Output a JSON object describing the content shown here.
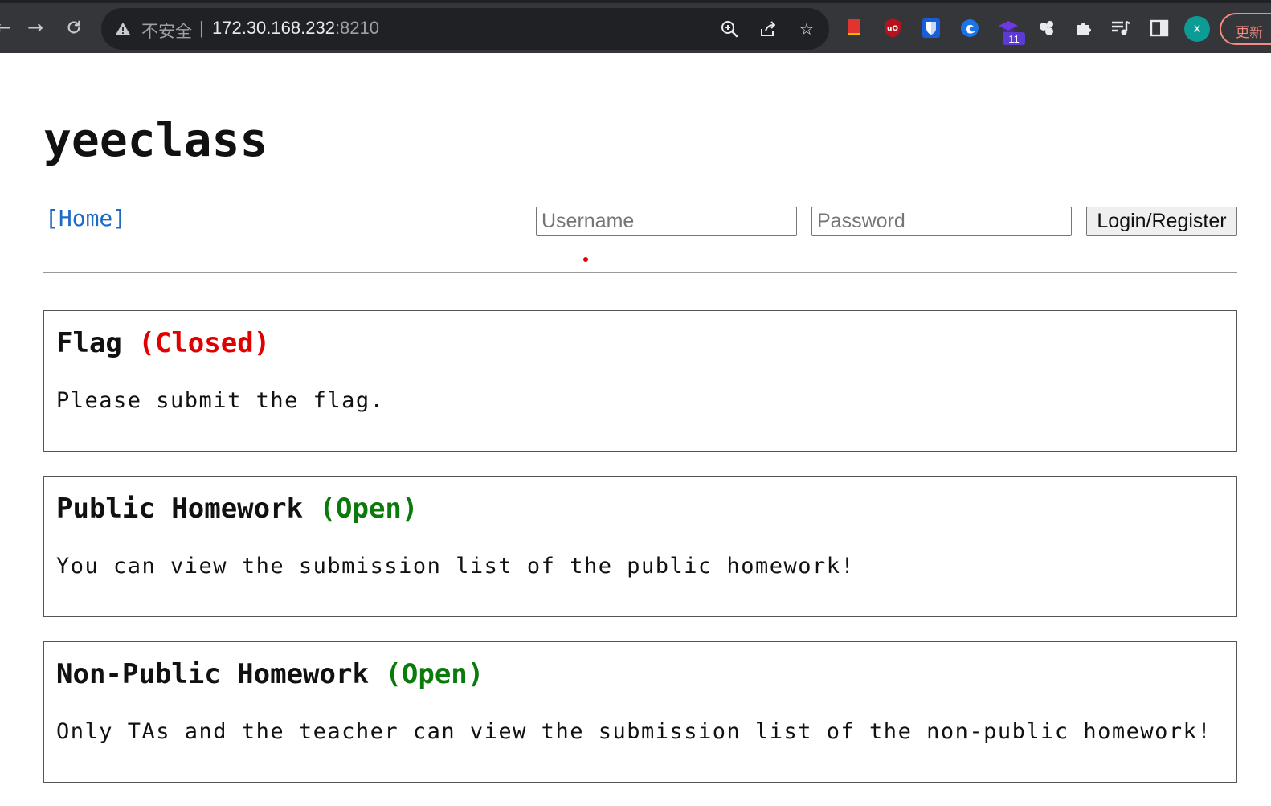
{
  "browser": {
    "back_icon": "arrow-left-icon",
    "forward_icon": "arrow-right-icon",
    "reload_icon": "reload-icon",
    "security_label": "不安全",
    "separator": "|",
    "url_host": "172.30.168.232",
    "url_port": ":8210",
    "zoom_icon": "zoom-icon",
    "share_icon": "share-icon",
    "bookmark_icon": "star-icon",
    "extensions": [
      {
        "name": "bookmark-ext-icon",
        "color": "#e0352f"
      },
      {
        "name": "ublock-icon",
        "color": "#b5121b",
        "text": "uO"
      },
      {
        "name": "bitwarden-icon",
        "color": "#175ddc"
      },
      {
        "name": "edge-ext-icon",
        "color": "#1a73e8"
      },
      {
        "name": "graduation-cap-ext-icon",
        "color": "#6c3ae0",
        "badge": "11"
      },
      {
        "name": "blobs-ext-icon",
        "color": "#e8eaed"
      },
      {
        "name": "puzzle-extensions-icon",
        "color": "#e8eaed"
      },
      {
        "name": "media-queue-icon",
        "color": "#e8eaed"
      },
      {
        "name": "sidepanel-icon",
        "color": "#e8eaed"
      }
    ],
    "profile_initial": "x",
    "update_label": "更新"
  },
  "site": {
    "title": "yeeclass",
    "home_link": "[Home]"
  },
  "login": {
    "username_placeholder": "Username",
    "password_placeholder": "Password",
    "submit_label": "Login/Register"
  },
  "homeworks": [
    {
      "name": "Flag",
      "status": "(Closed)",
      "status_color": "#e00000",
      "description": "Please submit the flag."
    },
    {
      "name": "Public Homework",
      "status": "(Open)",
      "status_color": "#0a7a0a",
      "description": "You can view the submission list of the public homework!"
    },
    {
      "name": "Non-Public Homework",
      "status": "(Open)",
      "status_color": "#0a7a0a",
      "description": "Only TAs and the teacher can view the submission list of the non-public homework!"
    }
  ]
}
